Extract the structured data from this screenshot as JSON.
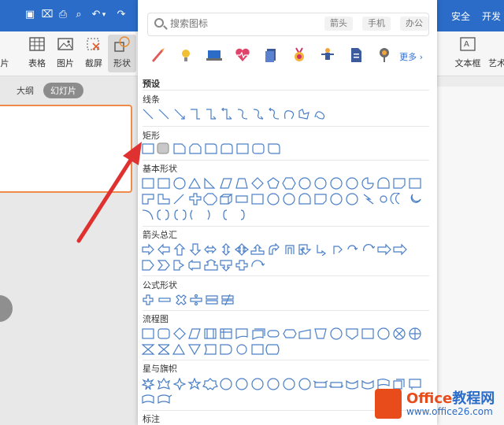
{
  "top_menu": {
    "security": "安全",
    "developer": "开发"
  },
  "ribbon": {
    "left_partial_label": "片",
    "table_label": "表格",
    "picture_label": "图片",
    "screenshot_label": "截屏",
    "shapes_label": "形状",
    "textbox_label": "文本框",
    "art_partial_label": "艺术"
  },
  "left_pane": {
    "tab_outline": "大纲",
    "tab_slides": "幻灯片"
  },
  "panel": {
    "search_placeholder": "搜索图标",
    "chips": [
      "箭头",
      "手机",
      "办公"
    ],
    "more": "更多 ›",
    "preset_heading": "预设",
    "sections": {
      "lines": "线条",
      "rect": "矩形",
      "basic": "基本形状",
      "arrows": "箭头总汇",
      "formula": "公式形状",
      "flowchart": "流程图",
      "stars": "星与旗帜",
      "callouts": "标注"
    }
  },
  "watermark": {
    "brand_a": "Office",
    "brand_b": "教程网",
    "url": "www.office26.com"
  },
  "colors": {
    "accent": "#2a6cc7",
    "shape_stroke": "#4a7fc7",
    "highlight": "#f08a4b",
    "annotation_red": "#e03131"
  }
}
